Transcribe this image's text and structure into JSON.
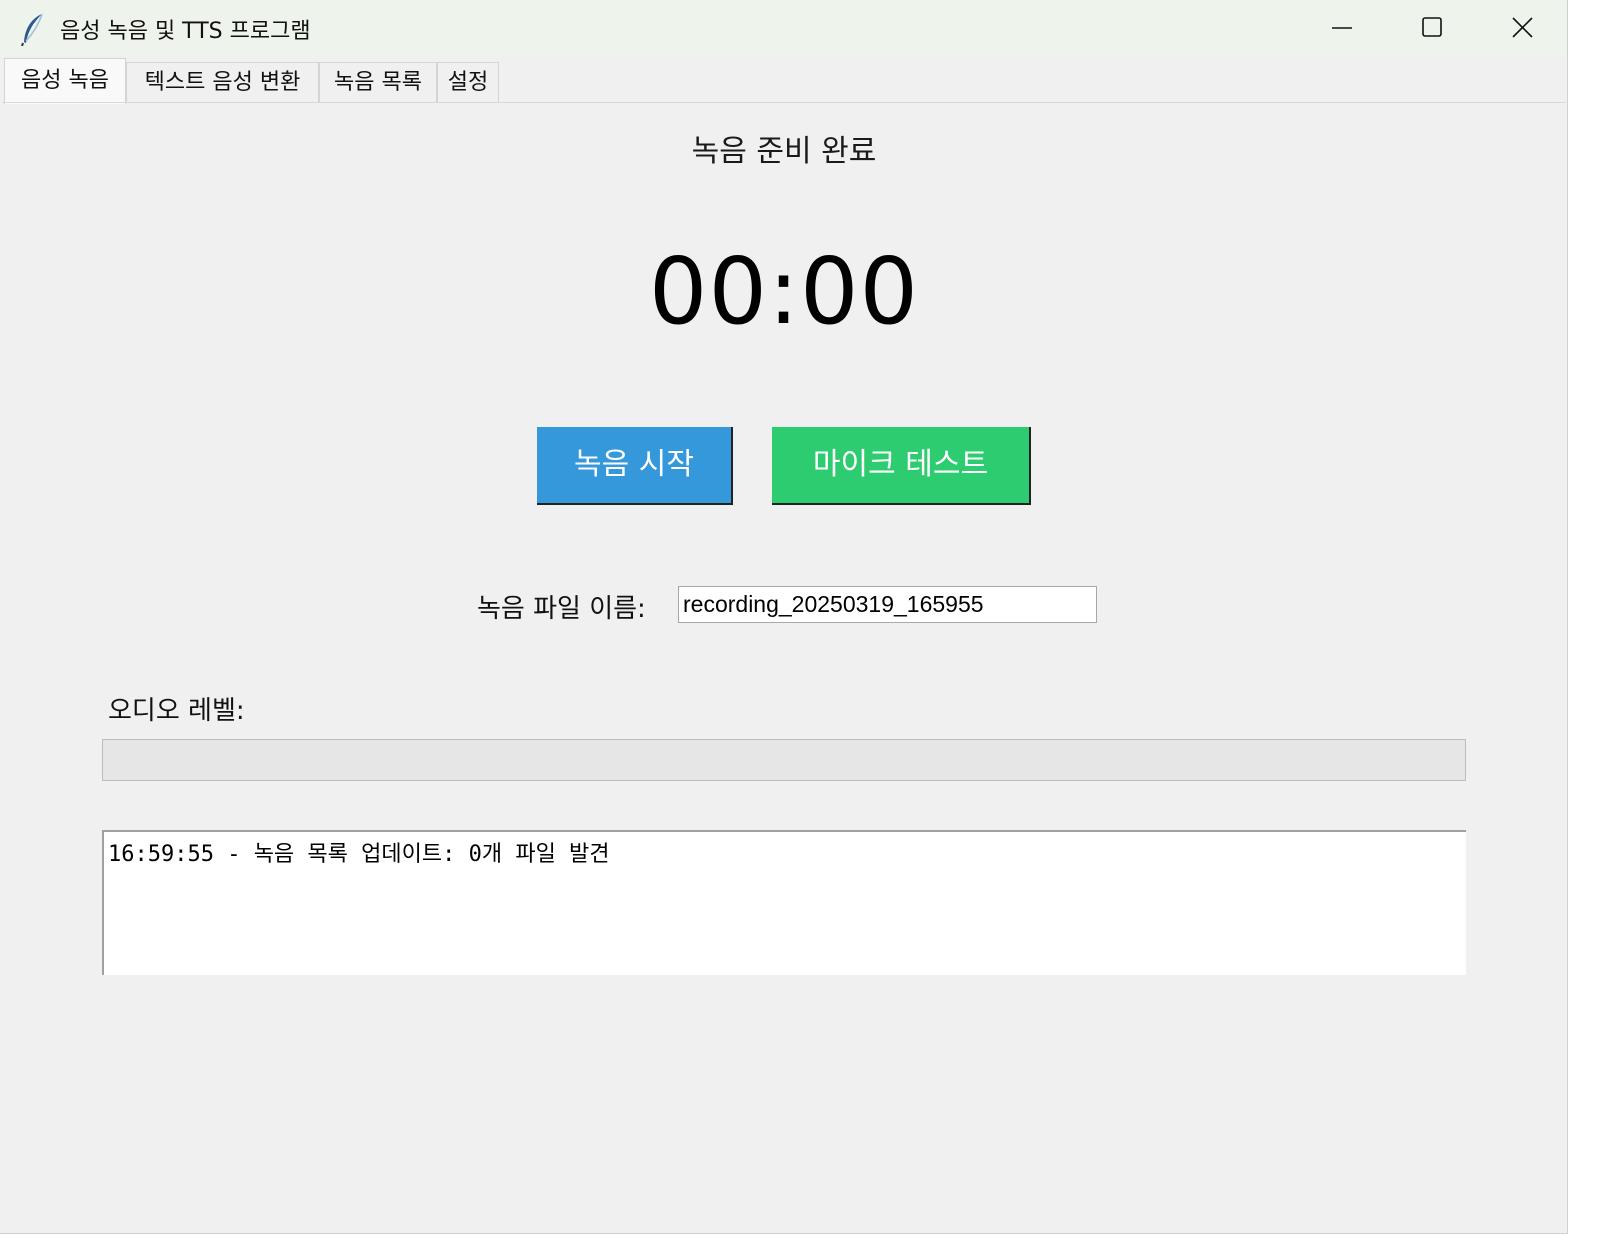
{
  "window": {
    "title": "음성 녹음 및 TTS 프로그램",
    "icon": "feather-icon"
  },
  "tabs": [
    {
      "label": "음성 녹음",
      "active": true
    },
    {
      "label": "텍스트 음성 변환",
      "active": false
    },
    {
      "label": "녹음 목록",
      "active": false
    },
    {
      "label": "설정",
      "active": false
    }
  ],
  "recording": {
    "status": "녹음 준비 완료",
    "timer": "00:00",
    "start_button": "녹음 시작",
    "mic_test_button": "마이크 테스트",
    "filename_label": "녹음 파일 이름:",
    "filename_value": "recording_20250319_165955",
    "audio_level_label": "오디오 레벨:",
    "audio_level": 0,
    "log": "16:59:55 - 녹음 목록 업데이트: 0개 파일 발견"
  },
  "colors": {
    "start_button": "#3498db",
    "mic_test_button": "#2ecc71"
  }
}
